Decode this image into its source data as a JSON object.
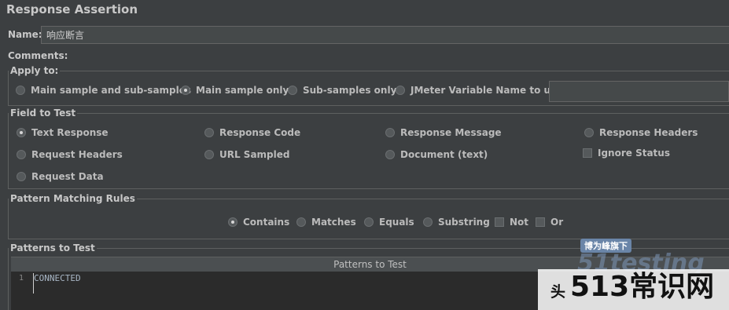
{
  "panel": {
    "title": "Response Assertion"
  },
  "name": {
    "label": "Name:",
    "value": "响应断言"
  },
  "comments": {
    "label": "Comments:",
    "value": ""
  },
  "apply_to": {
    "legend": "Apply to:",
    "options": [
      {
        "label": "Main sample and sub-samples",
        "selected": false
      },
      {
        "label": "Main sample only",
        "selected": true
      },
      {
        "label": "Sub-samples only",
        "selected": false
      },
      {
        "label": "JMeter Variable Name to use",
        "selected": false
      }
    ],
    "variable_value": ""
  },
  "field_to_test": {
    "legend": "Field to Test",
    "options": [
      {
        "label": "Text Response",
        "selected": true
      },
      {
        "label": "Response Code",
        "selected": false
      },
      {
        "label": "Response Message",
        "selected": false
      },
      {
        "label": "Response Headers",
        "selected": false
      },
      {
        "label": "Request Headers",
        "selected": false
      },
      {
        "label": "URL Sampled",
        "selected": false
      },
      {
        "label": "Document (text)",
        "selected": false
      },
      {
        "label": "Request Data",
        "selected": false
      }
    ],
    "ignore_status": {
      "label": "Ignore Status",
      "checked": false
    }
  },
  "pattern_matching": {
    "legend": "Pattern Matching Rules",
    "options": [
      {
        "label": "Contains",
        "selected": true
      },
      {
        "label": "Matches",
        "selected": false
      },
      {
        "label": "Equals",
        "selected": false
      },
      {
        "label": "Substring",
        "selected": false
      }
    ],
    "not": {
      "label": "Not",
      "checked": false
    },
    "or": {
      "label": "Or",
      "checked": false
    }
  },
  "patterns": {
    "legend": "Patterns to Test",
    "column_header": "Patterns to Test",
    "rows": [
      {
        "line": "1",
        "text": "CONNECTED"
      }
    ]
  },
  "watermark": {
    "slogan": "博为峰旗下",
    "brand": "51testing",
    "site_prefix": "头",
    "site_name": "513常识网"
  }
}
